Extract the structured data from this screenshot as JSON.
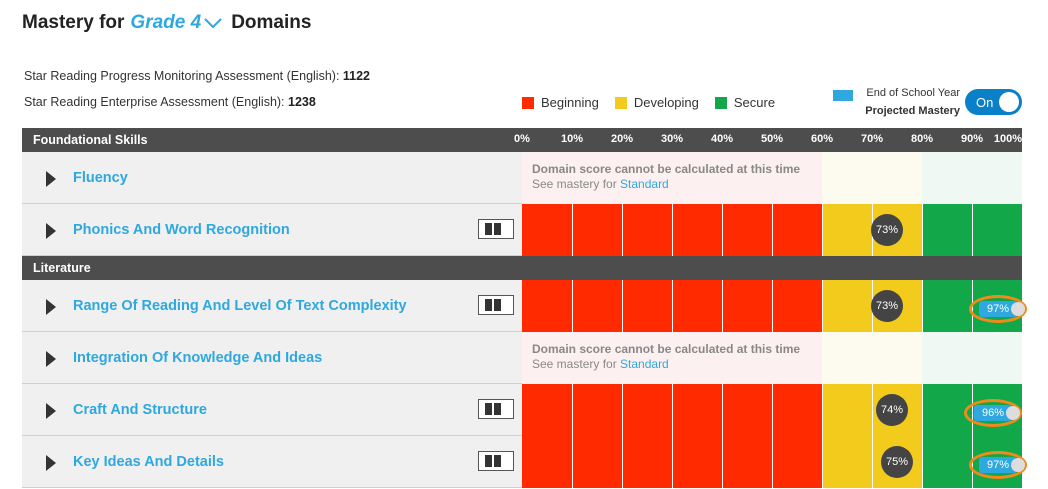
{
  "header": {
    "title_prefix": "Mastery for",
    "grade": "Grade 4",
    "title_suffix": "Domains"
  },
  "assessments": [
    {
      "label": "Star Reading Progress Monitoring Assessment (English): ",
      "score": "1122"
    },
    {
      "label": "Star Reading Enterprise Assessment (English): ",
      "score": "1238"
    }
  ],
  "legend": [
    {
      "label": "Beginning",
      "color": "#ff2a00"
    },
    {
      "label": "Developing",
      "color": "#f2cb1d"
    },
    {
      "label": "Secure",
      "color": "#12a84a"
    }
  ],
  "projection": {
    "line1": "End of School Year",
    "line2": "Projected Mastery",
    "toggle_label": "On",
    "color": "#2ea8df"
  },
  "scale_ticks": [
    "0%",
    "10%",
    "20%",
    "30%",
    "40%",
    "50%",
    "60%",
    "70%",
    "80%",
    "90%",
    "100%"
  ],
  "na_message": {
    "line1": "Domain score cannot be calculated at this time",
    "line2_prefix": "See mastery for ",
    "line2_link": "Standard"
  },
  "groups": [
    {
      "name": "Foundational Skills",
      "domains": [
        {
          "name": "Fluency",
          "available": false
        },
        {
          "name": "Phonics And Word Recognition",
          "available": true,
          "score": 73,
          "score_label": "73%"
        }
      ]
    },
    {
      "name": "Literature",
      "domains": [
        {
          "name": "Range Of Reading And Level Of Text Complexity",
          "available": true,
          "score": 73,
          "score_label": "73%",
          "projected": 97,
          "projected_label": "97%"
        },
        {
          "name": "Integration Of Knowledge And Ideas",
          "available": false
        },
        {
          "name": "Craft And Structure",
          "available": true,
          "score": 74,
          "score_label": "74%",
          "projected": 96,
          "projected_label": "96%"
        },
        {
          "name": "Key Ideas And Details",
          "available": true,
          "score": 75,
          "score_label": "75%",
          "projected": 97,
          "projected_label": "97%"
        }
      ]
    }
  ]
}
